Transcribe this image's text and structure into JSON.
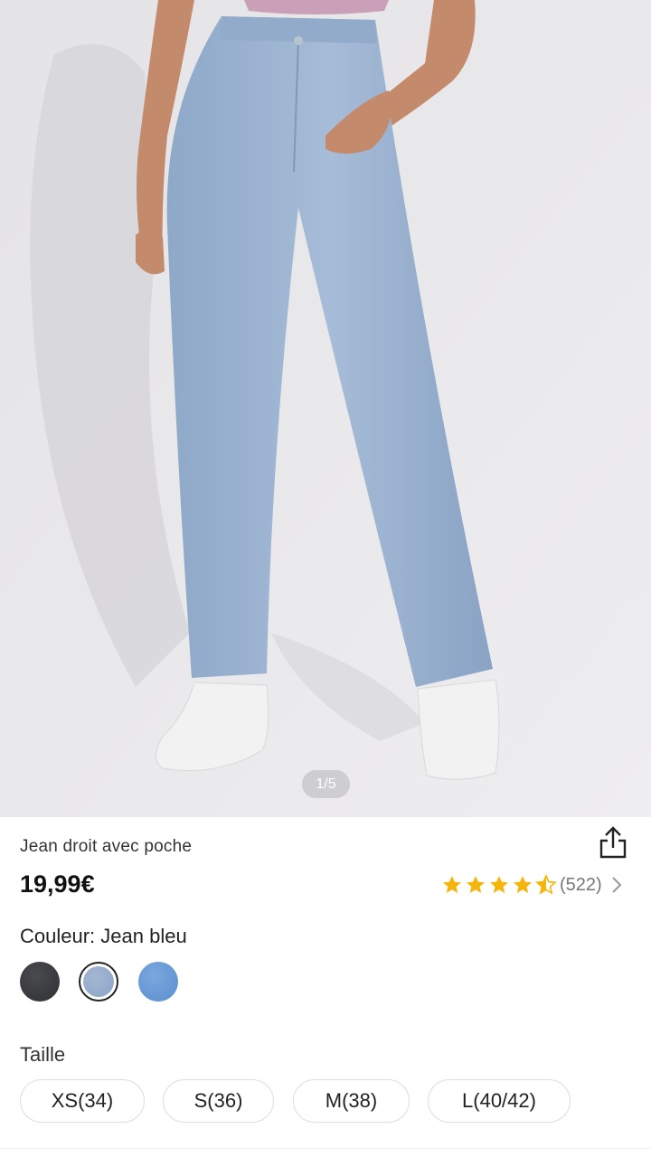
{
  "gallery": {
    "page_indicator": "1/5",
    "current_page": 1,
    "total_pages": 5
  },
  "product": {
    "title": "Jean droit avec poche",
    "price": "19,99€",
    "rating": {
      "stars": 4.5,
      "count_text": "(522)"
    }
  },
  "colors": {
    "label": "Couleur: Jean bleu",
    "swatches": [
      {
        "name": "black",
        "hex": "#2f3033",
        "selected": false
      },
      {
        "name": "light-blue",
        "hex": "#8ca4c8",
        "selected": true
      },
      {
        "name": "blue",
        "hex": "#5b8fcf",
        "selected": false
      }
    ]
  },
  "sizes": {
    "label": "Taille",
    "options": [
      "XS(34)",
      "S(36)",
      "M(38)",
      "L(40/42)"
    ]
  },
  "icons": {
    "share": "share-icon",
    "chevron": "chevron-right-icon",
    "star": "star-icon"
  },
  "accent": {
    "star": "#f5b50a"
  }
}
